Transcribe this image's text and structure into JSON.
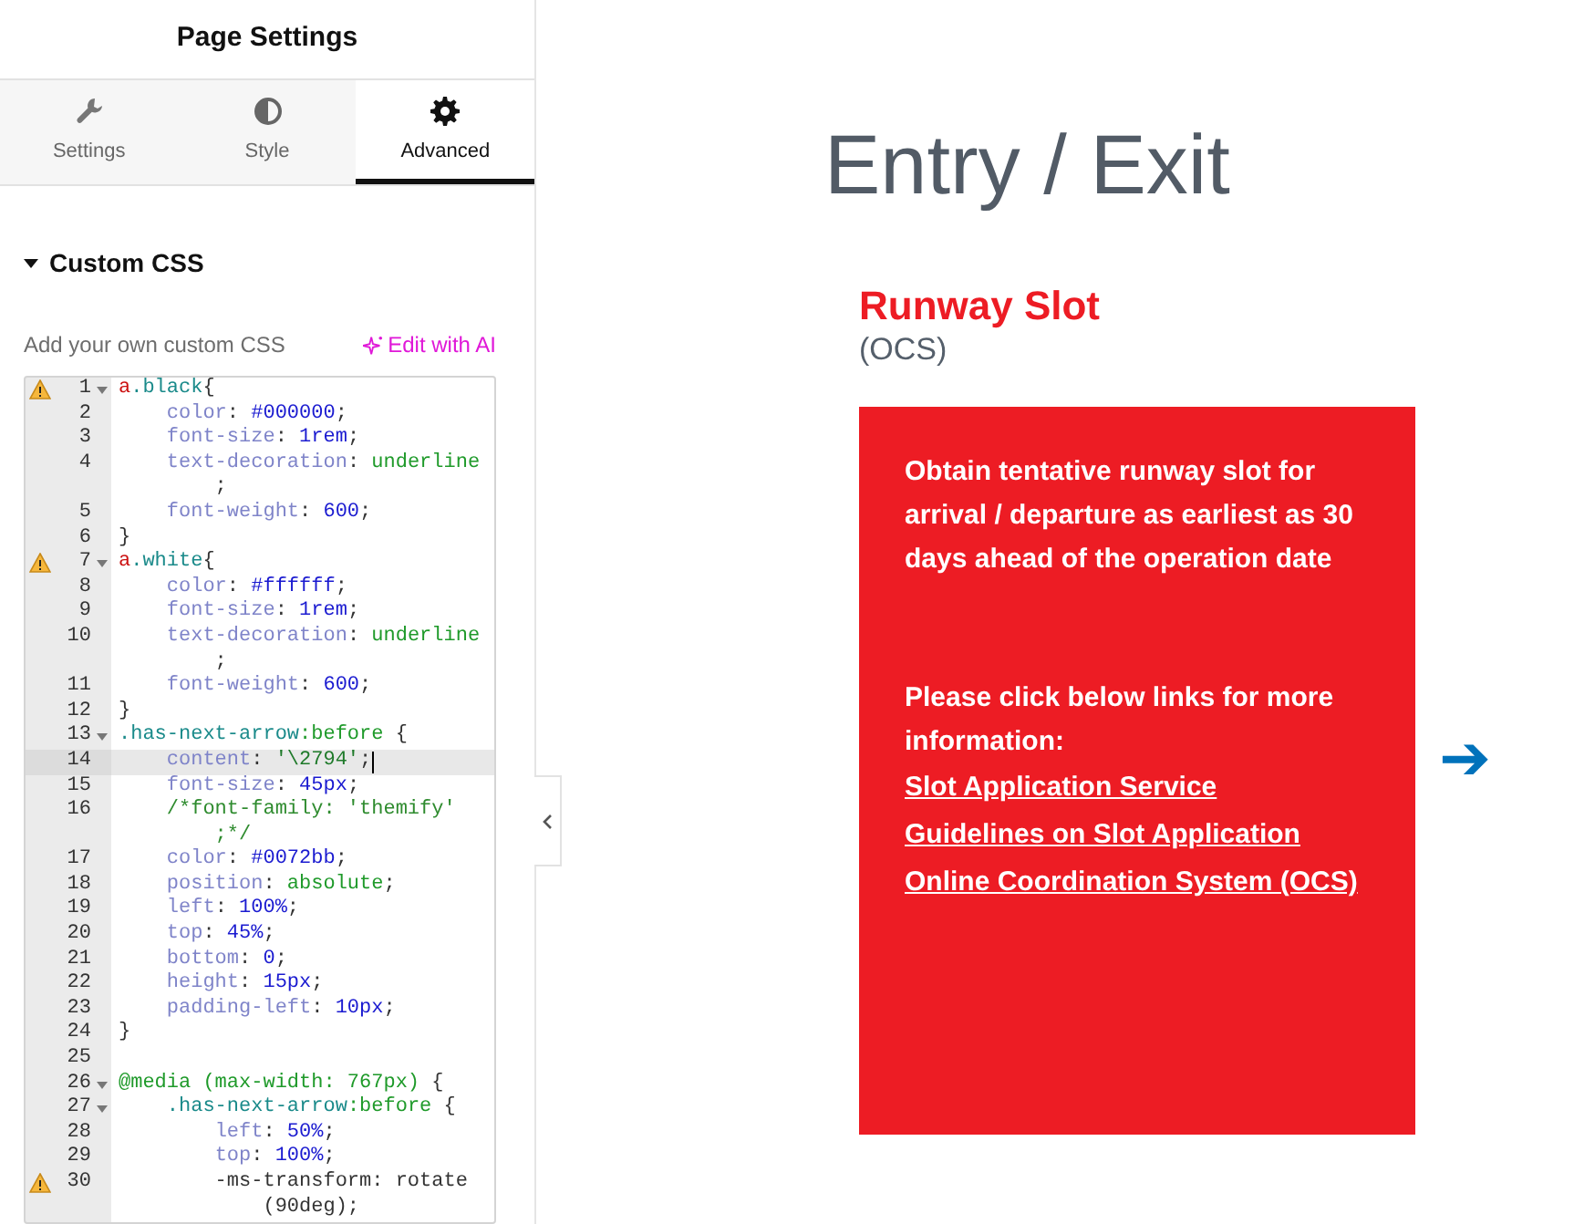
{
  "panel": {
    "title": "Page Settings",
    "tabs": [
      {
        "label": "Settings",
        "selected": false
      },
      {
        "label": "Style",
        "selected": false
      },
      {
        "label": "Advanced",
        "selected": true
      }
    ],
    "section": {
      "title": "Custom CSS",
      "expanded": true,
      "hint": "Add your own custom CSS",
      "ai_link": "Edit with AI"
    },
    "code_lines": [
      {
        "number": "1",
        "fold": true,
        "warning": true,
        "active": false,
        "text": "a.black{"
      },
      {
        "number": "2",
        "fold": false,
        "warning": false,
        "active": false,
        "text": "    color: #000000;"
      },
      {
        "number": "3",
        "fold": false,
        "warning": false,
        "active": false,
        "text": "    font-size: 1rem;"
      },
      {
        "number": "4",
        "fold": false,
        "warning": false,
        "active": false,
        "text": "    text-decoration: underline"
      },
      {
        "text": "        ;"
      },
      {
        "number": "5",
        "fold": false,
        "warning": false,
        "active": false,
        "text": "    font-weight: 600;"
      },
      {
        "number": "6",
        "fold": false,
        "warning": false,
        "active": false,
        "text": "}"
      },
      {
        "number": "7",
        "fold": true,
        "warning": true,
        "active": false,
        "text": "a.white{"
      },
      {
        "number": "8",
        "fold": false,
        "warning": false,
        "active": false,
        "text": "    color: #ffffff;"
      },
      {
        "number": "9",
        "fold": false,
        "warning": false,
        "active": false,
        "text": "    font-size: 1rem;"
      },
      {
        "number": "10",
        "fold": false,
        "warning": false,
        "active": false,
        "text": "    text-decoration: underline"
      },
      {
        "text": "        ;"
      },
      {
        "number": "11",
        "fold": false,
        "warning": false,
        "active": false,
        "text": "    font-weight: 600;"
      },
      {
        "number": "12",
        "fold": false,
        "warning": false,
        "active": false,
        "text": "}"
      },
      {
        "number": "13",
        "fold": true,
        "warning": false,
        "active": false,
        "text": ".has-next-arrow:before {"
      },
      {
        "number": "14",
        "fold": false,
        "warning": false,
        "active": true,
        "text": "    content: '\\2794';"
      },
      {
        "number": "15",
        "fold": false,
        "warning": false,
        "active": false,
        "text": "    font-size: 45px;"
      },
      {
        "number": "16",
        "fold": false,
        "warning": false,
        "active": false,
        "text": "    /*font-family: 'themify'"
      },
      {
        "text": "        ;*/"
      },
      {
        "number": "17",
        "fold": false,
        "warning": false,
        "active": false,
        "text": "    color: #0072bb;"
      },
      {
        "number": "18",
        "fold": false,
        "warning": false,
        "active": false,
        "text": "    position: absolute;"
      },
      {
        "number": "19",
        "fold": false,
        "warning": false,
        "active": false,
        "text": "    left: 100%;"
      },
      {
        "number": "20",
        "fold": false,
        "warning": false,
        "active": false,
        "text": "    top: 45%;"
      },
      {
        "number": "21",
        "fold": false,
        "warning": false,
        "active": false,
        "text": "    bottom: 0;"
      },
      {
        "number": "22",
        "fold": false,
        "warning": false,
        "active": false,
        "text": "    height: 15px;"
      },
      {
        "number": "23",
        "fold": false,
        "warning": false,
        "active": false,
        "text": "    padding-left: 10px;"
      },
      {
        "number": "24",
        "fold": false,
        "warning": false,
        "active": false,
        "text": "}"
      },
      {
        "number": "25",
        "fold": false,
        "warning": false,
        "active": false
      },
      {
        "number": "26",
        "fold": true,
        "warning": false,
        "active": false,
        "text": "@media (max-width: 767px) {"
      },
      {
        "number": "27",
        "fold": true,
        "warning": false,
        "active": false,
        "text": "    .has-next-arrow:before {"
      },
      {
        "number": "28",
        "fold": false,
        "warning": false,
        "active": false,
        "text": "        left: 50%;"
      },
      {
        "number": "29",
        "fold": false,
        "warning": false,
        "active": false,
        "text": "        top: 100%;"
      },
      {
        "number": "30",
        "fold": false,
        "warning": true,
        "active": false,
        "text": "        -ms-transform: rotate"
      },
      {
        "text": "            (90deg);"
      }
    ]
  },
  "preview": {
    "heading": "Entry / Exit",
    "card_title": "Runway Slot",
    "card_subtitle": "(OCS)",
    "description": "Obtain tentative runway slot for arrival / departure as earliest as 30 days ahead of the operation date",
    "links_intro": "Please click below links for more information:",
    "links": [
      "Slot Application Service",
      "Guidelines on Slot Application",
      "Online Coordination System (OCS)"
    ],
    "next_arrow": "➔"
  }
}
